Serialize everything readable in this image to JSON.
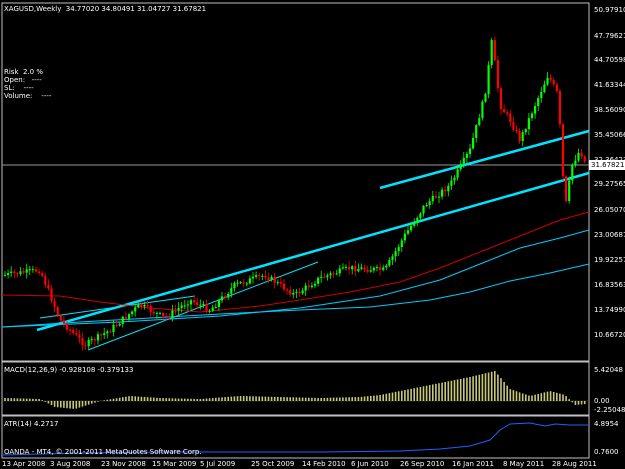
{
  "header": {
    "symbol_line": "XAGUSD,Weekly  34.77020 34.80491 31.04727 31.67821"
  },
  "info_panel": {
    "risk": "Risk  2.0 %",
    "open": "Open:   ----",
    "sl": "SL:    ----",
    "volume": "Volume:    ----"
  },
  "price_axis": [
    "50.97910",
    "47.79621",
    "44.70598",
    "41.63344",
    "38.56090",
    "35.45066",
    "32.36423",
    "29.27565",
    "26.05070",
    "23.00687",
    "19.92257",
    "16.83563",
    "13.74990",
    "10.66720"
  ],
  "current_price": "31.67821",
  "macd": {
    "label": "MACD(12,26,9) -0.928108 -0.379133",
    "axis": [
      "5.42048",
      "0.00",
      "-2.25048"
    ]
  },
  "atr": {
    "label": "ATR(14) 4.2717",
    "axis": [
      "4.8954",
      "0.7600"
    ]
  },
  "copyright": "OANDA - MT4, © 2001-2011 MetaQuotes Software Corp.",
  "time_axis": [
    "13 Apr 2008",
    "3 Aug 2008",
    "23 Nov 2008",
    "15 Mar 2009",
    "5 Jul 2009",
    "25 Oct 2009",
    "14 Feb 2010",
    "6 Jun 2010",
    "26 Sep 2010",
    "16 Jan 2011",
    "8 May 2011",
    "28 Aug 2011"
  ],
  "colors": {
    "background": "#000000",
    "grid": "#c0c0c0",
    "bull_candle": "#00ff00",
    "bear_candle": "#ff0000",
    "trend_line": "#00e5ff",
    "ma_fast": "#cc0000",
    "ma_slow": "#00ccff",
    "macd_hist": "#c8c878",
    "atr_line": "#2060ff"
  }
}
